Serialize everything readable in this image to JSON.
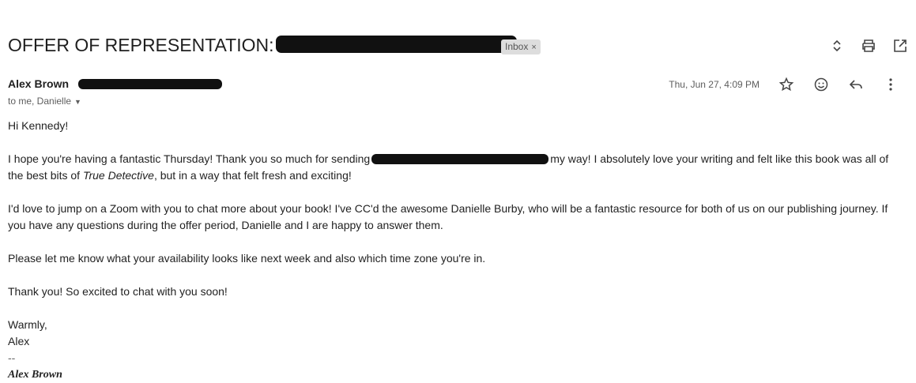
{
  "subject": {
    "title": "OFFER OF REPRESENTATION:",
    "label_chip": "Inbox",
    "label_remove": "×"
  },
  "toolbar": {
    "icons": [
      "expand-collapse-icon",
      "print-icon",
      "open-in-new-window-icon"
    ]
  },
  "sender": {
    "name": "Alex Brown",
    "recipients": "to me, Danielle",
    "date": "Thu, Jun 27, 4:09 PM"
  },
  "message": {
    "greeting": "Hi Kennedy!",
    "p1_before": "I hope you're having a fantastic Thursday! Thank you so much for sending",
    "p1_after": "my way! I absolutely love your writing and felt like this book was all of the best bits of",
    "p1_italic": "True Detective",
    "p1_end": ", but in a way that felt fresh and exciting!",
    "p2": "I'd love to jump on a Zoom with you to chat more about your book! I've CC'd the awesome Danielle Burby, who will be a fantastic resource for both of us on our publishing journey. If you have any questions during the offer period, Danielle and I are happy to answer them.",
    "p3": "Please let me know what your availability looks like next week and also which time zone you're in.",
    "p4": "Thank you! So excited to chat with you soon!",
    "closing": "Warmly,",
    "sign_name": "Alex",
    "sig_separator": "--",
    "sig_full_name": "Alex Brown"
  }
}
